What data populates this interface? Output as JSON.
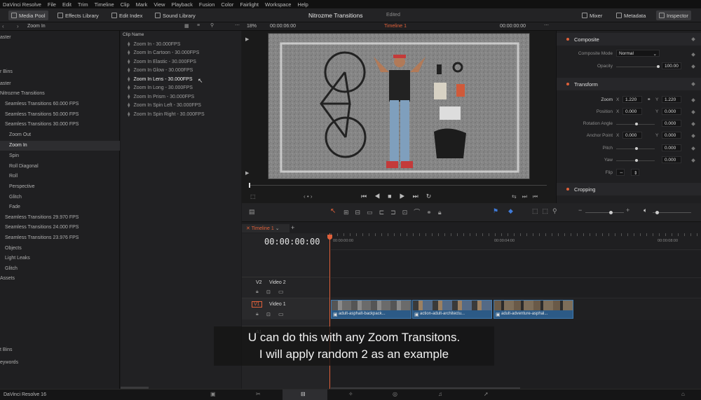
{
  "menu": [
    "DaVinci Resolve",
    "File",
    "Edit",
    "Trim",
    "Timeline",
    "Clip",
    "Mark",
    "View",
    "Playback",
    "Fusion",
    "Color",
    "Fairlight",
    "Workspace",
    "Help"
  ],
  "toolbar": {
    "media_pool": "Media Pool",
    "effects_library": "Effects Library",
    "edit_index": "Edit Index",
    "sound_library": "Sound Library",
    "project_title": "Nitrozme Transitions",
    "project_status": "Edited",
    "mixer": "Mixer",
    "metadata": "Metadata",
    "inspector": "Inspector"
  },
  "subbar": {
    "bin_name": "Zoom In",
    "clip_name_header": "Clip Name",
    "zoom": "18%",
    "source_timecode": "00:00:06:00",
    "timeline_name": "Timeline 1",
    "record_timecode": "00:00:00:00"
  },
  "bins": {
    "items": [
      "aster",
      "r Bins",
      "aster",
      "Nitrozme Transitions",
      "Seamless Transitions 60.000 FPS",
      "Seamless Transitions 50.000 FPS",
      "Seamless Transitions 30.000 FPS",
      "Zoom Out",
      "Zoom In",
      "Spin",
      "Roll Diagonal",
      "Roll",
      "Perspective",
      "Glitch",
      "Fade",
      "Seamless Transitions 29.970 FPS",
      "Seamless Transitions 24.000 FPS",
      "Seamless Transitions 23.976 FPS",
      "Objects",
      "Light Leaks",
      "Glitch",
      "Assets",
      "t Bins",
      "eywords"
    ]
  },
  "clips": [
    "Zoom In - 30.000FPS",
    "Zoom In Cartoon - 30.000FPS",
    "Zoom In Elastic - 30.000FPS",
    "Zoom In Glow - 30.000FPS",
    "Zoom In Lens - 30.000FPS",
    "Zoom In Long - 30.000FPS",
    "Zoom In Prism - 30.000FPS",
    "Zoom In Spin Left - 30.000FPS",
    "Zoom In Spin Right - 30.000FPS"
  ],
  "inspector": {
    "composite": "Composite",
    "composite_mode_label": "Composite Mode",
    "composite_mode_value": "Normal",
    "opacity_label": "Opacity",
    "opacity_value": "100.00",
    "transform": "Transform",
    "zoom_label": "Zoom",
    "zoom_x": "1.220",
    "zoom_y": "1.220",
    "position_label": "Position",
    "position_x": "0.000",
    "position_y": "0.000",
    "rotation_label": "Rotation Angle",
    "rotation_value": "0.000",
    "anchor_label": "Anchor Point",
    "anchor_x": "0.000",
    "anchor_y": "0.000",
    "pitch_label": "Pitch",
    "pitch_value": "0.000",
    "yaw_label": "Yaw",
    "yaw_value": "0.000",
    "flip_label": "Flip",
    "x_axis": "X",
    "y_axis": "Y",
    "cropping": "Cropping"
  },
  "timeline": {
    "tab": "Timeline 1",
    "timecode": "00:00:00:00",
    "ruler": [
      "00:00:00:00",
      "00:00:04:00",
      "00:00:08:00"
    ],
    "tracks": [
      {
        "id": "V2",
        "name": "Video 2"
      },
      {
        "id": "V1",
        "name": "Video 1"
      },
      {
        "id": "A1",
        "name": ""
      }
    ],
    "clips": [
      "adult-asphalt-backpack...",
      "action-adult-architectu...",
      "adult-adventure-asphal..."
    ]
  },
  "subtitle": {
    "line1": "U can do this with any Zoom Transitons.",
    "line2": "I will apply random 2 as an example"
  },
  "pagebar": {
    "app_name": "DaVinci Resolve 16"
  }
}
